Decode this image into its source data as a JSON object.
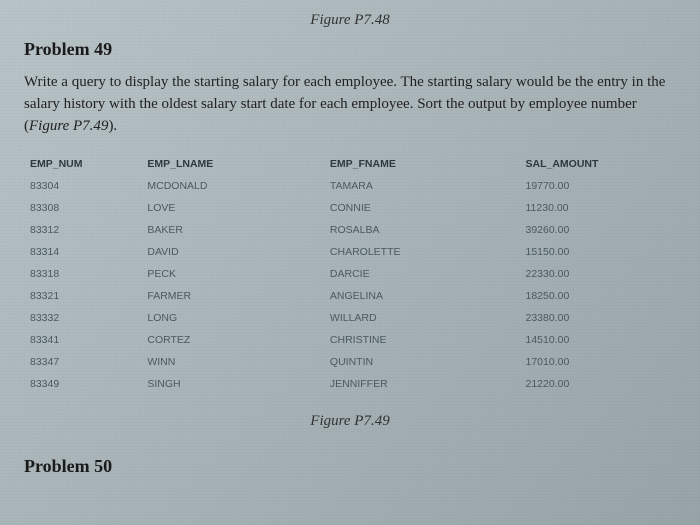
{
  "figure_top": "Figure P7.48",
  "problem49": {
    "heading": "Problem 49",
    "text_part1": "Write a query to display the starting salary for each employee. The starting salary would be the entry in the salary history with the oldest salary start date for each employee. Sort the output by employee number (",
    "text_figref": "Figure P7.49",
    "text_part2": ")."
  },
  "table": {
    "headers": [
      "EMP_NUM",
      "EMP_LNAME",
      "EMP_FNAME",
      "SAL_AMOUNT"
    ],
    "rows": [
      [
        "83304",
        "MCDONALD",
        "TAMARA",
        "19770.00"
      ],
      [
        "83308",
        "LOVE",
        "CONNIE",
        "11230.00"
      ],
      [
        "83312",
        "BAKER",
        "ROSALBA",
        "39260.00"
      ],
      [
        "83314",
        "DAVID",
        "CHAROLETTE",
        "15150.00"
      ],
      [
        "83318",
        "PECK",
        "DARCIE",
        "22330.00"
      ],
      [
        "83321",
        "FARMER",
        "ANGELINA",
        "18250.00"
      ],
      [
        "83332",
        "LONG",
        "WILLARD",
        "23380.00"
      ],
      [
        "83341",
        "CORTEZ",
        "CHRISTINE",
        "14510.00"
      ],
      [
        "83347",
        "WINN",
        "QUINTIN",
        "17010.00"
      ],
      [
        "83349",
        "SINGH",
        "JENNIFFER",
        "21220.00"
      ]
    ]
  },
  "figure_bottom": "Figure P7.49",
  "problem50": {
    "heading": "Problem 50"
  }
}
